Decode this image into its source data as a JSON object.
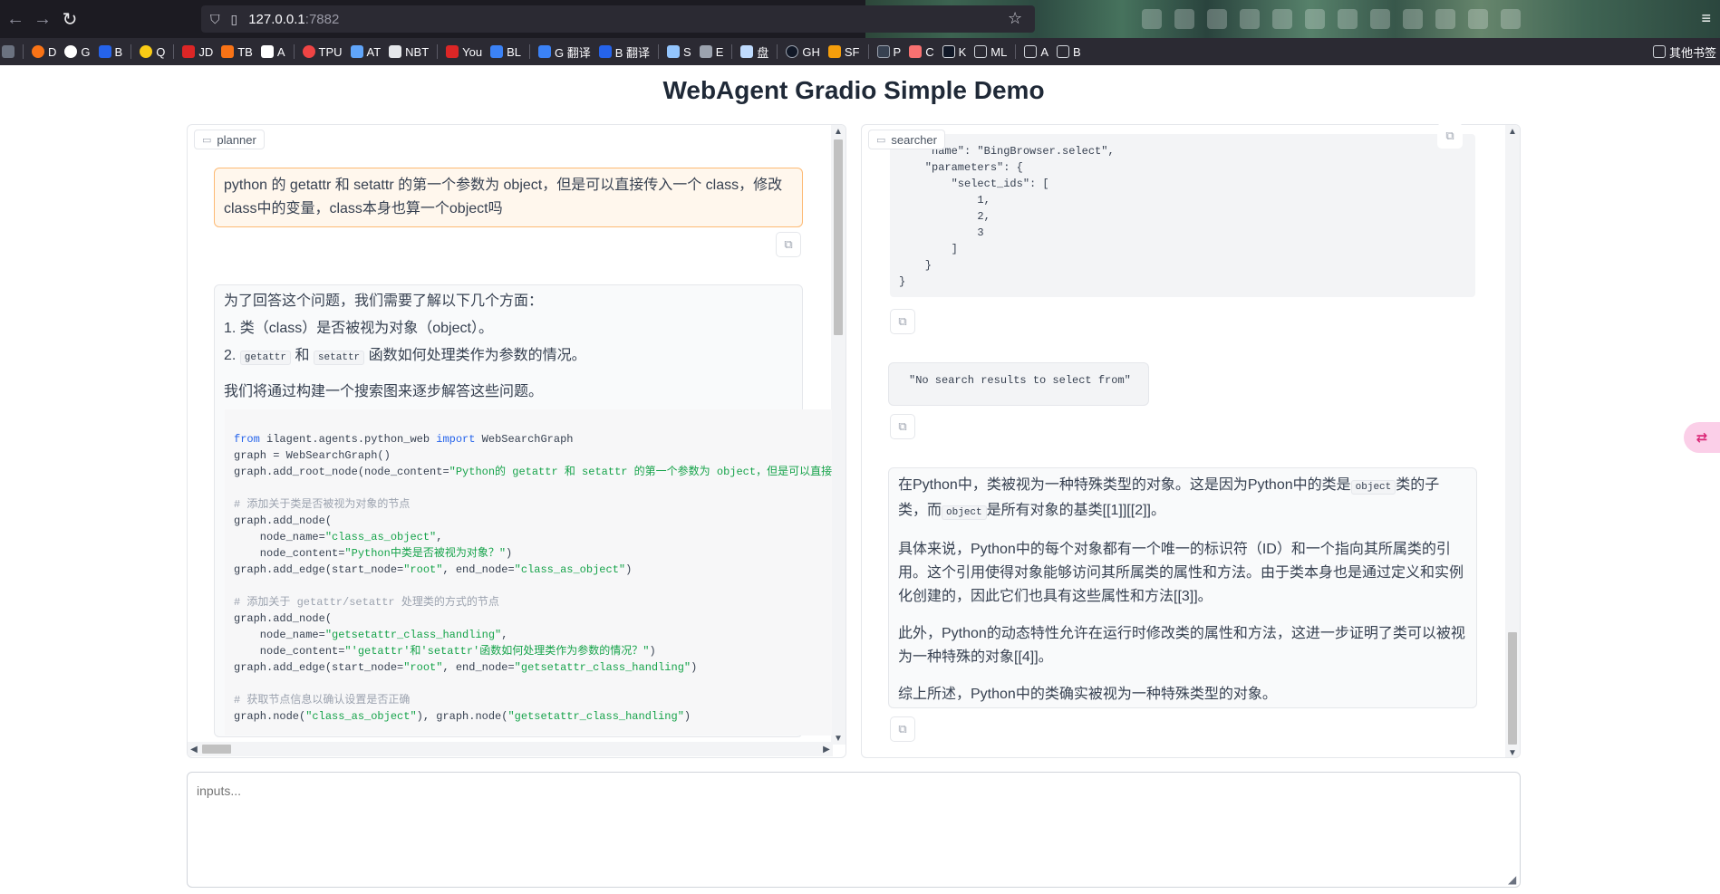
{
  "browser": {
    "url_host": "127.0.0.1",
    "url_port": ":7882",
    "bookmarks": [
      "D",
      "G",
      "B",
      "Q",
      "JD",
      "TB",
      "A",
      "TPU",
      "AT",
      "NBT",
      "You",
      "BL",
      "G 翻译",
      "B 翻译",
      "S",
      "E",
      "盘",
      "GH",
      "SF",
      "P",
      "C",
      "K",
      "ML",
      "A",
      "B"
    ],
    "bookmarks_right": "其他书签"
  },
  "page": {
    "title": "WebAgent Gradio Simple Demo"
  },
  "planner": {
    "label": "planner",
    "user_message": "python 的 getattr 和 setattr 的第一个参数为 object，但是可以直接传入一个 class，修改class中的变量，class本身也算一个object吗",
    "reply_intro": "为了回答这个问题，我们需要了解以下几个方面：",
    "reply_item1": "1. 类（class）是否被视为对象（object）。",
    "reply_item2_prefix": "2.",
    "reply_item2_code_a": "getattr",
    "reply_item2_and": "和",
    "reply_item2_code_b": "setattr",
    "reply_item2_suffix": "函数如何处理类作为参数的情况。",
    "reply_plan": "我们将通过构建一个搜索图来逐步解答这些问题。",
    "code_lines": [
      [
        {
          "t": "from",
          "c": "kw"
        },
        {
          "t": " ilagent.agents.python_web ",
          "c": ""
        },
        {
          "t": "import",
          "c": "kw"
        },
        {
          "t": " WebSearchGraph",
          "c": ""
        }
      ],
      [
        {
          "t": "graph = WebSearchGraph()",
          "c": ""
        }
      ],
      [
        {
          "t": "graph.add_root_node(node_content=",
          "c": ""
        },
        {
          "t": "\"Python的 getattr 和 setattr 的第一个参数为 object，但是可以直接传",
          "c": "str"
        }
      ],
      [
        {
          "t": "",
          "c": ""
        }
      ],
      [
        {
          "t": "# 添加关于类是否被视为对象的节点",
          "c": "cm"
        }
      ],
      [
        {
          "t": "graph.add_node(",
          "c": ""
        }
      ],
      [
        {
          "t": "    node_name=",
          "c": ""
        },
        {
          "t": "\"class_as_object\"",
          "c": "str"
        },
        {
          "t": ",",
          "c": ""
        }
      ],
      [
        {
          "t": "    node_content=",
          "c": ""
        },
        {
          "t": "\"Python中类是否被视为对象？\"",
          "c": "str"
        },
        {
          "t": ")",
          "c": ""
        }
      ],
      [
        {
          "t": "graph.add_edge(start_node=",
          "c": ""
        },
        {
          "t": "\"root\"",
          "c": "str"
        },
        {
          "t": ", end_node=",
          "c": ""
        },
        {
          "t": "\"class_as_object\"",
          "c": "str"
        },
        {
          "t": ")",
          "c": ""
        }
      ],
      [
        {
          "t": "",
          "c": ""
        }
      ],
      [
        {
          "t": "# 添加关于 getattr/setattr 处理类的方式的节点",
          "c": "cm"
        }
      ],
      [
        {
          "t": "graph.add_node(",
          "c": ""
        }
      ],
      [
        {
          "t": "    node_name=",
          "c": ""
        },
        {
          "t": "\"getsetattr_class_handling\"",
          "c": "str"
        },
        {
          "t": ",",
          "c": ""
        }
      ],
      [
        {
          "t": "    node_content=",
          "c": ""
        },
        {
          "t": "\"'getattr'和'setattr'函数如何处理类作为参数的情况？\"",
          "c": "str"
        },
        {
          "t": ")",
          "c": ""
        }
      ],
      [
        {
          "t": "graph.add_edge(start_node=",
          "c": ""
        },
        {
          "t": "\"root\"",
          "c": "str"
        },
        {
          "t": ", end_node=",
          "c": ""
        },
        {
          "t": "\"getsetattr_class_handling\"",
          "c": "str"
        },
        {
          "t": ")",
          "c": ""
        }
      ],
      [
        {
          "t": "",
          "c": ""
        }
      ],
      [
        {
          "t": "# 获取节点信息以确认设置是否正确",
          "c": "cm"
        }
      ],
      [
        {
          "t": "graph.node(",
          "c": ""
        },
        {
          "t": "\"class_as_object\"",
          "c": "str"
        },
        {
          "t": "), graph.node(",
          "c": ""
        },
        {
          "t": "\"getsetattr_class_handling\"",
          "c": "str"
        },
        {
          "t": ")",
          "c": ""
        }
      ]
    ]
  },
  "searcher": {
    "label": "searcher",
    "json_lines": [
      "    \"name\": \"BingBrowser.select\",",
      "    \"parameters\": {",
      "        \"select_ids\": [",
      "            1,",
      "            2,",
      "            3",
      "        ]",
      "    }",
      "}"
    ],
    "no_results": "\"No search results to select from\"",
    "answer_p1_a": "在Python中，类被视为一种特殊类型的对象。这是因为Python中的类是",
    "answer_p1_code_a": "object",
    "answer_p1_b": "类的子类，而",
    "answer_p1_code_b": "object",
    "answer_p1_c": "是所有对象的基类[[1]][[2]]。",
    "answer_p2": "具体来说，Python中的每个对象都有一个唯一的标识符（ID）和一个指向其所属类的引用。这个引用使得对象能够访问其所属类的属性和方法。由于类本身也是通过定义和实例化创建的，因此它们也具有这些属性和方法[[3]]。",
    "answer_p3": "此外，Python的动态特性允许在运行时修改类的属性和方法，这进一步证明了类可以被视为一种特殊的对象[[4]]。",
    "answer_p4": "综上所述，Python中的类确实被视为一种特殊类型的对象。"
  },
  "input": {
    "placeholder": "inputs..."
  },
  "icons": {
    "copy": "copy-icon",
    "chat": "chat-bubble-icon",
    "translate": "translate-icon"
  }
}
